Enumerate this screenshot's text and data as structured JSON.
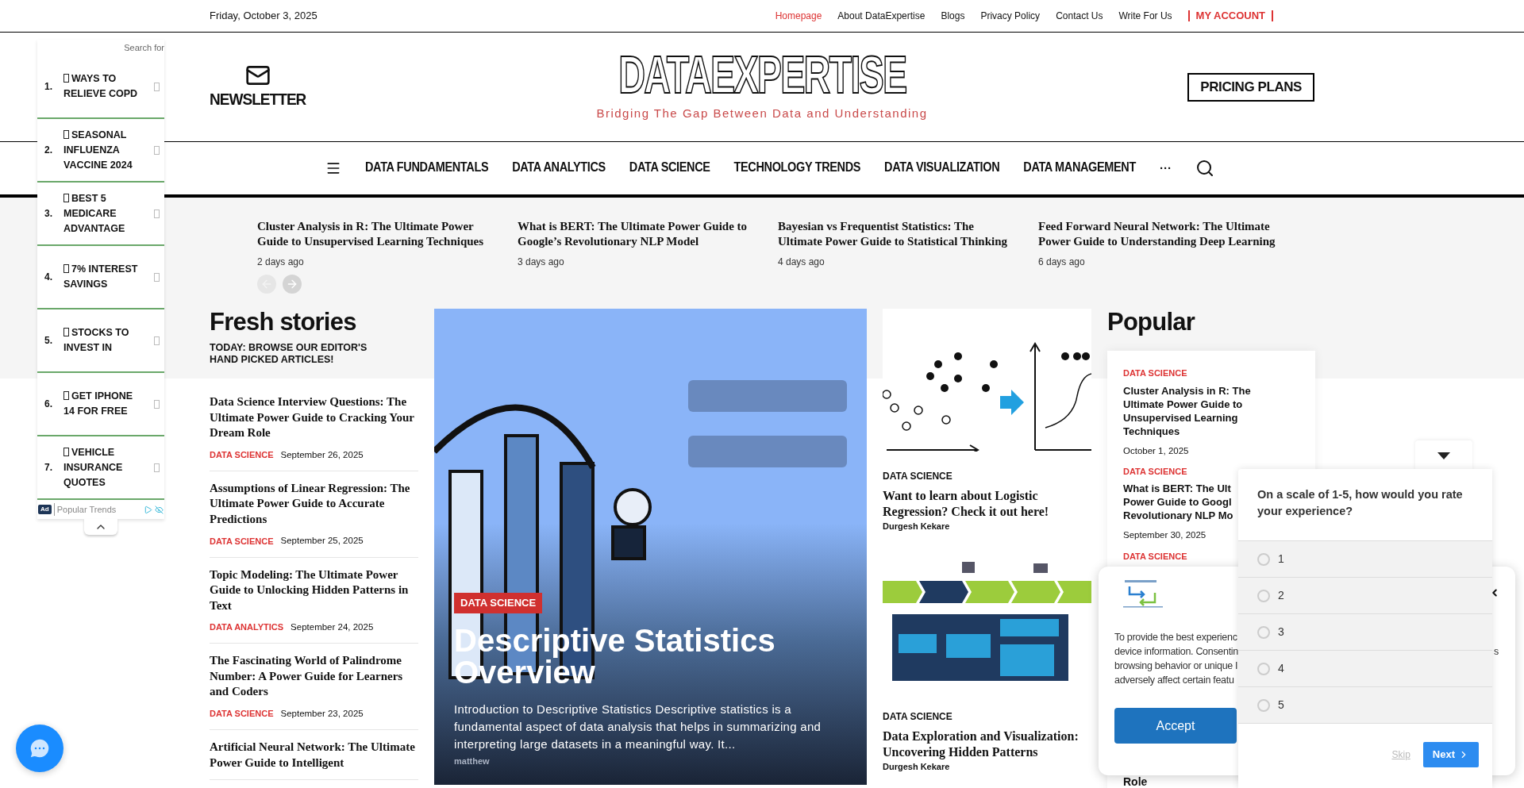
{
  "top_bar": {
    "date": "Friday, October 3, 2025",
    "links": [
      {
        "label": "Homepage",
        "selected": true
      },
      {
        "label": "About DataExpertise",
        "selected": false
      },
      {
        "label": "Blogs",
        "selected": false
      },
      {
        "label": "Privacy Policy",
        "selected": false
      },
      {
        "label": "Contact Us",
        "selected": false
      },
      {
        "label": "Write For Us",
        "selected": false
      }
    ],
    "account": "MY ACCOUNT"
  },
  "header": {
    "newsletter": "NEWSLETTER",
    "logo": "DATAEXPERTISE",
    "tagline": "Bridging The Gap Between Data and Understanding",
    "pricing_button": "PRICING PLANS"
  },
  "nav": {
    "items": [
      "DATA FUNDAMENTALS",
      "DATA ANALYTICS",
      "DATA SCIENCE",
      "TECHNOLOGY TRENDS",
      "DATA VISUALIZATION",
      "DATA MANAGEMENT"
    ],
    "more": "···"
  },
  "ticker": {
    "items": [
      {
        "title": "Cluster Analysis in R: The Ultimate Power Guide to Unsupervised Learning Techniques",
        "time": "2 days ago"
      },
      {
        "title": "What is BERT: The Ultimate Power Guide to Google’s Revolutionary NLP Model",
        "time": "3 days ago"
      },
      {
        "title": "Bayesian vs Frequentist Statistics: The Ultimate Power Guide to Statistical Thinking",
        "time": "4 days ago"
      },
      {
        "title": "Feed Forward Neural Network: The Ultimate Power Guide to Understanding Deep Learning",
        "time": "6 days ago"
      }
    ],
    "prev_disabled": true,
    "next_disabled": false
  },
  "fresh_stories": {
    "title": "Fresh stories",
    "subtitle": "TODAY: BROWSE OUR EDITOR'S HAND PICKED ARTICLES!",
    "items": [
      {
        "title": "Data Science Interview Questions: The Ultimate Power Guide to Cracking Your Dream Role",
        "category": "DATA SCIENCE",
        "date": "September 26, 2025"
      },
      {
        "title": "Assumptions of Linear Regression: The Ultimate Power Guide to Accurate Predictions",
        "category": "DATA SCIENCE",
        "date": "September 25, 2025"
      },
      {
        "title": "Topic Modeling: The Ultimate Power Guide to Unlocking Hidden Patterns in Text",
        "category": "DATA ANALYTICS",
        "date": "September 24, 2025"
      },
      {
        "title": "The Fascinating World of Palindrome Number: A Power Guide for Learners and Coders",
        "category": "DATA SCIENCE",
        "date": "September 23, 2025"
      },
      {
        "title": "Artificial Neural Network: The Ultimate Power Guide to Intelligent"
      }
    ]
  },
  "hero": {
    "kind": "picture",
    "category": "DATA SCIENCE",
    "title": "Descriptive Statistics Overview",
    "excerpt": "Introduction to Descriptive Statistics Descriptive statistics is a fundamental aspect of data analysis that helps in summarizing and interpreting large datasets in a meaningful way. It...",
    "author": "matthew"
  },
  "cards": [
    {
      "category": "DATA SCIENCE",
      "title": "Want to learn about Logistic Regression? Check it out here!",
      "author": "Durgesh Kekare"
    },
    {
      "category": "DATA SCIENCE",
      "title": "Data Exploration and Visualization: Uncovering Hidden Patterns",
      "author": "Durgesh Kekare"
    }
  ],
  "popular": {
    "title": "Popular",
    "items": [
      {
        "category": "DATA SCIENCE",
        "title_lines": [
          "Cluster Analysis in R: The",
          "Ultimate Power Guide to",
          "Unsupervised Learning",
          "Techniques"
        ],
        "date": "October 1, 2025"
      },
      {
        "category": "DATA SCIENCE",
        "title_lines": [
          "What is BERT: The Ult",
          "Power Guide to Googl",
          "Revolutionary NLP Mo"
        ],
        "date": "September 30, 2025"
      },
      {
        "category": "DATA SCIENCE"
      }
    ],
    "tail": "Role"
  },
  "ad_sidebar": {
    "search_label": "Search for",
    "items": [
      {
        "number": "1.",
        "label": "WAYS TO RELIEVE COPD"
      },
      {
        "number": "2.",
        "label": "SEASONAL INFLUENZA VACCINE 2024"
      },
      {
        "number": "3.",
        "label": "BEST 5 MEDICARE ADVANTAGE"
      },
      {
        "number": "4.",
        "label": "7% INTEREST SAVINGS"
      },
      {
        "number": "5.",
        "label": "STOCKS TO INVEST IN"
      },
      {
        "number": "6.",
        "label": "GET IPHONE 14 FOR FREE"
      },
      {
        "number": "7.",
        "label": "VEHICLE INSURANCE QUOTES"
      }
    ],
    "ad_badge": "Ad",
    "source": "Popular Trends"
  },
  "consent": {
    "lines": [
      "To provide the best experienc",
      "device information. Consentin",
      "browsing behavior or unique I",
      "adversely affect certain featu"
    ],
    "fragment": "s",
    "accept": "Accept"
  },
  "survey": {
    "question": "On a scale of 1-5, how would you rate your experience?",
    "options": [
      {
        "label": "1",
        "selected": false
      },
      {
        "label": "2",
        "selected": false
      },
      {
        "label": "3",
        "selected": false
      },
      {
        "label": "4",
        "selected": false
      },
      {
        "label": "5",
        "selected": false
      }
    ],
    "skip": "Skip",
    "next": "Next"
  }
}
